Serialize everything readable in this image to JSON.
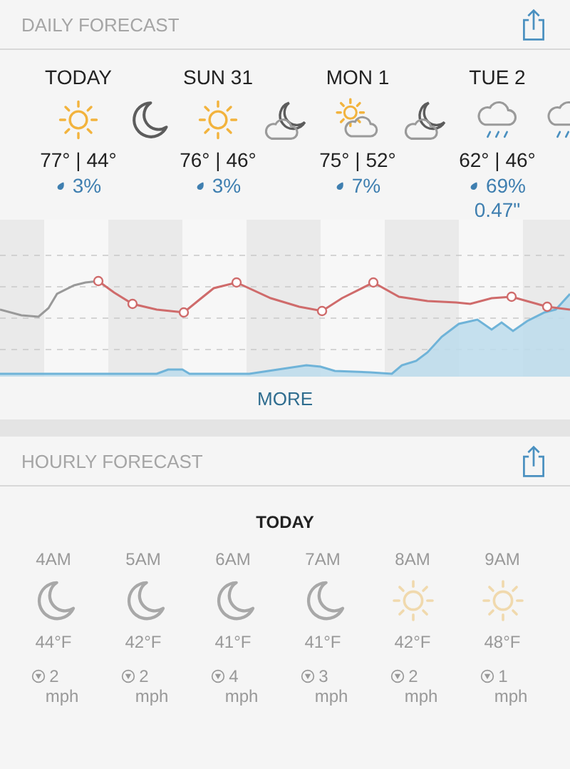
{
  "daily": {
    "title": "DAILY FORECAST",
    "strip": [
      {
        "kind": "sun",
        "label": "TODAY",
        "temps": "77° | 44°",
        "precip": "3%"
      },
      {
        "kind": "moon"
      },
      {
        "kind": "sun",
        "label": "SUN 31",
        "temps": "76° | 46°",
        "precip": "3%"
      },
      {
        "kind": "cloud-moon"
      },
      {
        "kind": "sun-cloud",
        "label": "MON 1",
        "temps": "75° | 52°",
        "precip": "7%"
      },
      {
        "kind": "cloud-moon"
      },
      {
        "kind": "rain",
        "label": "TUE 2",
        "temps": "62° | 46°",
        "precip": "69%",
        "amount": "0.47\""
      },
      {
        "kind": "rain"
      }
    ],
    "more": "MORE"
  },
  "hourly": {
    "title": "HOURLY FORECAST",
    "day": "TODAY",
    "hours": [
      {
        "kind": "moon",
        "time": "4AM",
        "temp": "44°F",
        "wind": "2",
        "unit": "mph"
      },
      {
        "kind": "moon",
        "time": "5AM",
        "temp": "42°F",
        "wind": "2",
        "unit": "mph"
      },
      {
        "kind": "moon",
        "time": "6AM",
        "temp": "41°F",
        "wind": "4",
        "unit": "mph"
      },
      {
        "kind": "moon",
        "time": "7AM",
        "temp": "41°F",
        "wind": "3",
        "unit": "mph"
      },
      {
        "kind": "sun",
        "time": "8AM",
        "temp": "42°F",
        "wind": "2",
        "unit": "mph"
      },
      {
        "kind": "sun",
        "time": "9AM",
        "temp": "48°F",
        "wind": "1",
        "unit": "mph"
      }
    ]
  }
}
